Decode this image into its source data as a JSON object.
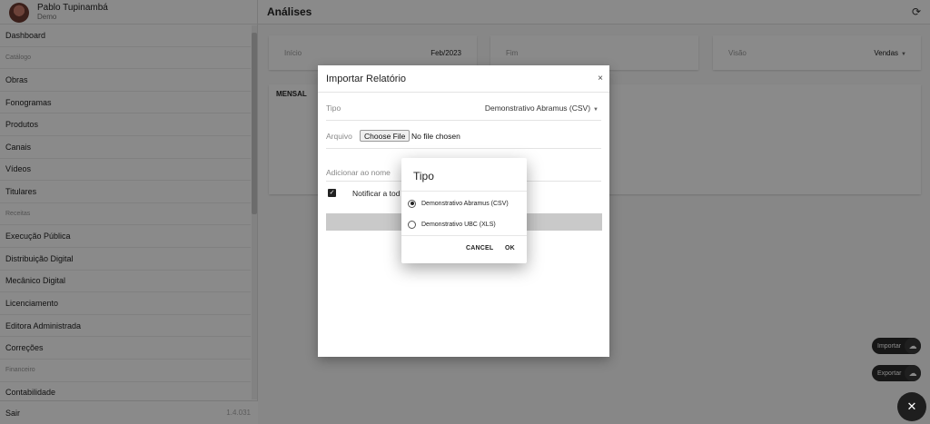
{
  "user": {
    "name": "Pablo Tupinambá",
    "subtitle": "Demo"
  },
  "sidebar": {
    "items": [
      {
        "type": "item",
        "label": "Dashboard"
      },
      {
        "type": "section",
        "label": "Catálogo"
      },
      {
        "type": "item",
        "label": "Obras"
      },
      {
        "type": "item",
        "label": "Fonogramas"
      },
      {
        "type": "item",
        "label": "Produtos"
      },
      {
        "type": "item",
        "label": "Canais"
      },
      {
        "type": "item",
        "label": "Vídeos"
      },
      {
        "type": "item",
        "label": "Titulares"
      },
      {
        "type": "section",
        "label": "Receitas"
      },
      {
        "type": "item",
        "label": "Execução Pública"
      },
      {
        "type": "item",
        "label": "Distribuição Digital"
      },
      {
        "type": "item",
        "label": "Mecânico Digital"
      },
      {
        "type": "item",
        "label": "Licenciamento"
      },
      {
        "type": "item",
        "label": "Editora Administrada"
      },
      {
        "type": "item",
        "label": "Correções"
      },
      {
        "type": "section",
        "label": "Financeiro"
      },
      {
        "type": "item",
        "label": "Contabilidade"
      }
    ],
    "logout_label": "Sair",
    "version": "1.4.031"
  },
  "header": {
    "title": "Análises",
    "refresh_icon": "refresh-icon"
  },
  "filters": {
    "inicio_label": "Início",
    "inicio_value": "Feb/2023",
    "fim_label": "Fim",
    "fim_value": "",
    "visao_label": "Visão",
    "visao_value": "Vendas"
  },
  "mensal": {
    "title": "MENSAL"
  },
  "import_dialog": {
    "title": "Importar Relatório",
    "close": "×",
    "tipo_label": "Tipo",
    "tipo_value": "Demonstrativo Abramus (CSV)",
    "arquivo_label": "Arquivo",
    "choose_file_label": "Choose File",
    "file_status": "No file chosen",
    "nome_label": "Adicionar ao nome",
    "notify_label": "Notificar a tod",
    "notify_checked": true
  },
  "tipo_picker": {
    "title": "Tipo",
    "options": [
      {
        "label": "Demonstrativo Abramus (CSV)",
        "selected": true
      },
      {
        "label": "Demonstrativo UBC (XLS)",
        "selected": false
      }
    ],
    "cancel_label": "CANCEL",
    "ok_label": "OK"
  },
  "fabs": {
    "import_label": "Importar",
    "export_label": "Exportar",
    "main_icon": "close-icon"
  },
  "colors": {
    "overlay": "#000000",
    "fab": "#2b2b2b",
    "accent": "#222222"
  }
}
